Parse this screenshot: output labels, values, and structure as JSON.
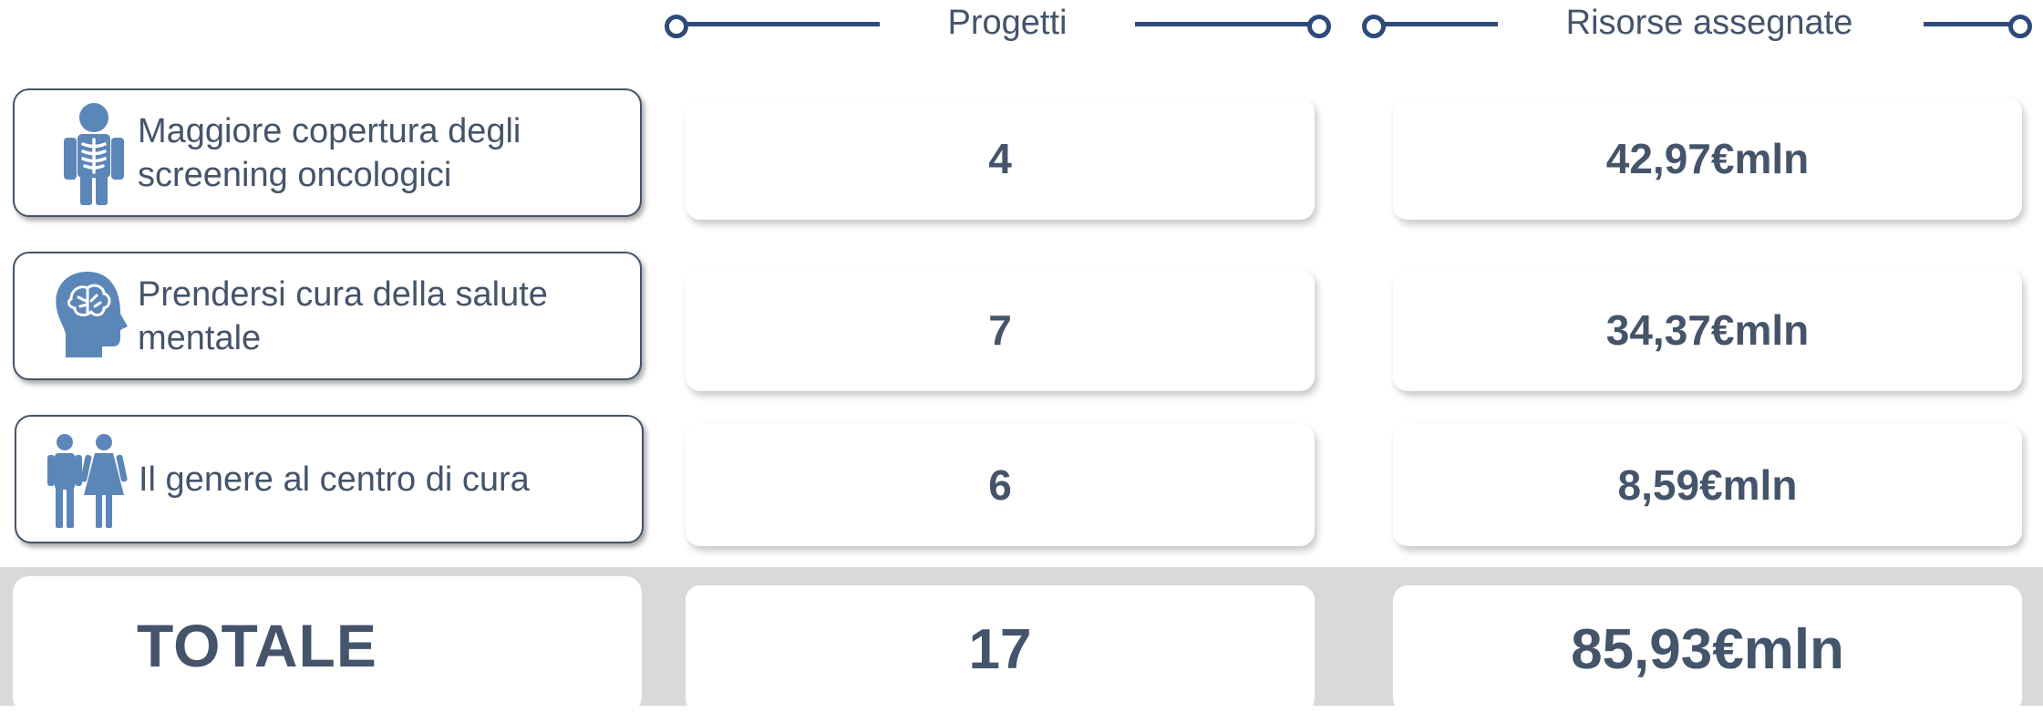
{
  "header": {
    "col1_label": "Progetti",
    "col2_label": "Risorse assegnate"
  },
  "rows": [
    {
      "label": "Maggiore copertura degli screening oncologici",
      "icon": "x-ray-icon",
      "progetti": "4",
      "risorse": "42,97€mln"
    },
    {
      "label": "Prendersi cura della salute mentale",
      "icon": "brain-head-icon",
      "progetti": "7",
      "risorse": "34,37€mln"
    },
    {
      "label": "Il genere al centro di cura",
      "icon": "man-woman-icon",
      "progetti": "6",
      "risorse": "8,59€mln"
    }
  ],
  "total": {
    "label": "TOTALE",
    "progetti": "17",
    "risorse": "85,93€mln"
  },
  "colors": {
    "text": "#44546a",
    "accent_line": "#2f4a7a",
    "icon": "#5b86b8",
    "total_band": "#d9d9d9"
  }
}
